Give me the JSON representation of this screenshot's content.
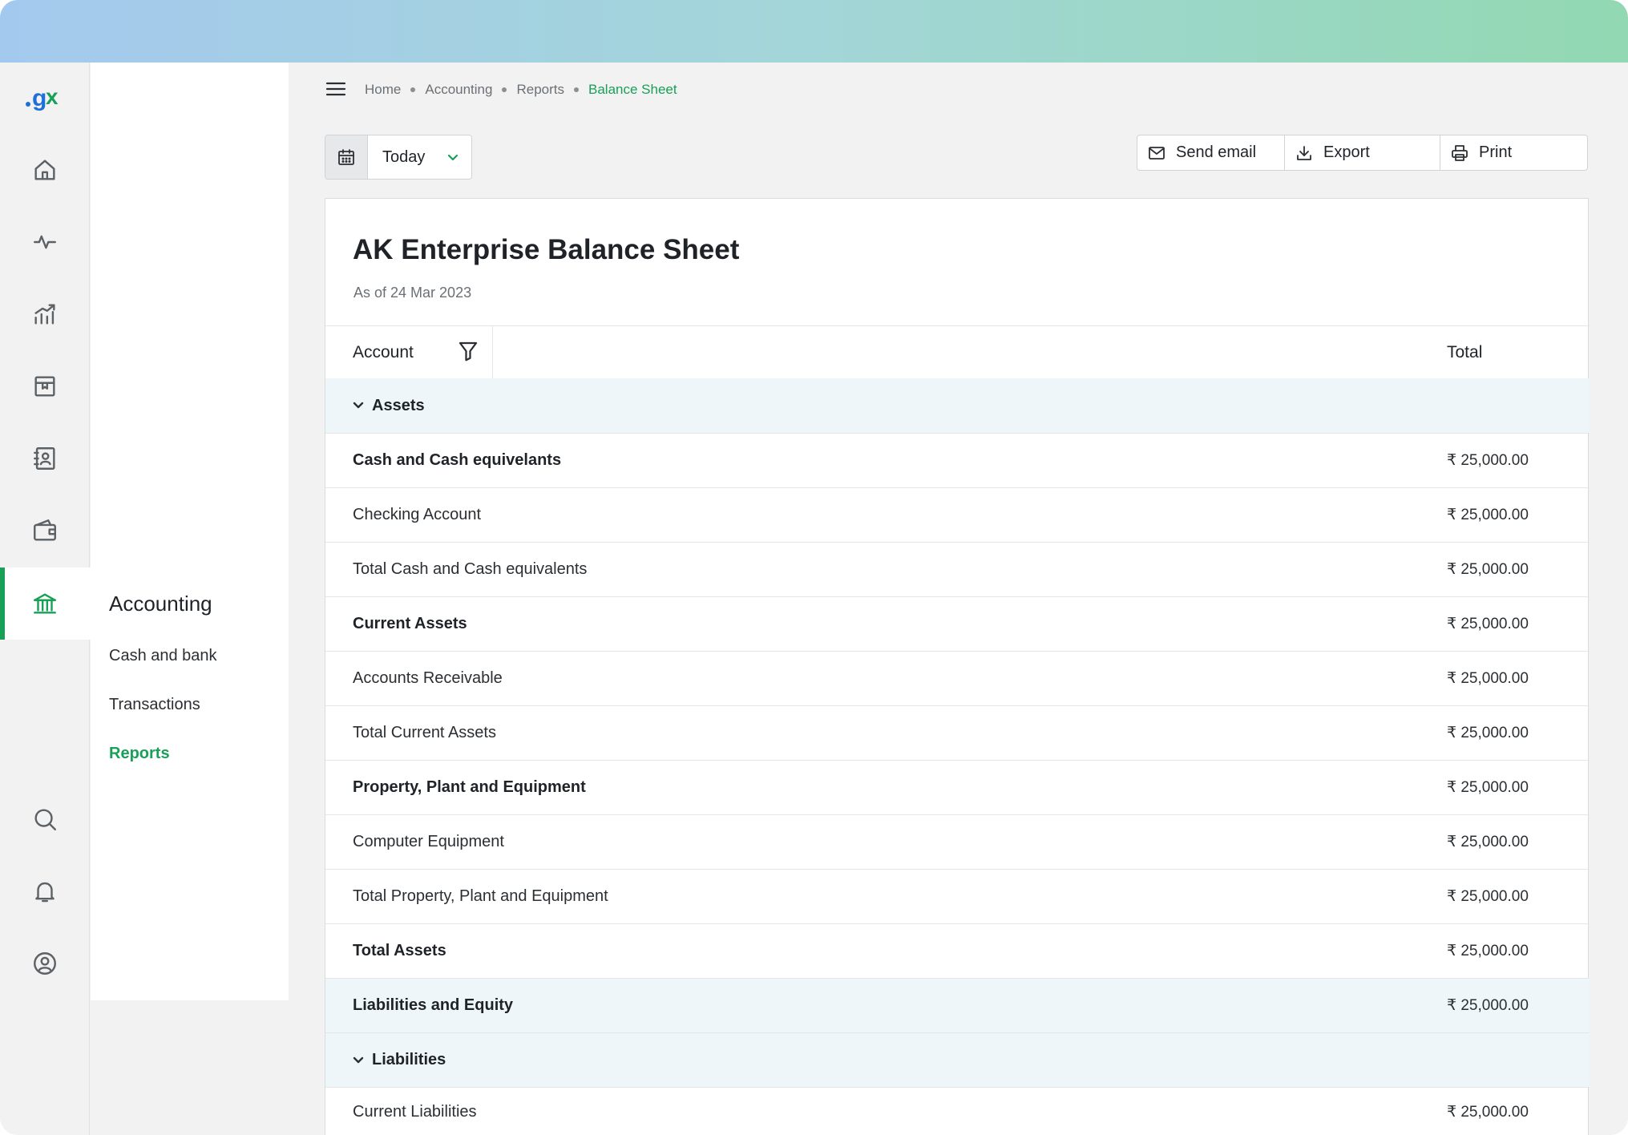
{
  "nav": {
    "rail_icons": [
      "home-icon",
      "activity-icon",
      "chart-icon",
      "inventory-icon",
      "contacts-icon",
      "wallet-icon",
      "bank-icon",
      "search-icon",
      "bell-icon",
      "profile-icon"
    ],
    "section_title": "Accounting",
    "items": [
      {
        "label": "Cash and bank"
      },
      {
        "label": "Transactions"
      },
      {
        "label": "Reports"
      }
    ]
  },
  "breadcrumb": [
    "Home",
    "Accounting",
    "Reports",
    "Balance Sheet"
  ],
  "date_filter": {
    "value": "Today"
  },
  "actions": {
    "send_email": "Send email",
    "export": "Export",
    "print": "Print"
  },
  "report": {
    "title": "AK Enterprise Balance Sheet",
    "as_of": "As of  24 Mar 2023",
    "col_account": "Account",
    "col_total": "Total",
    "rows": [
      {
        "label": "Assets",
        "amount": ""
      },
      {
        "label": "Cash and Cash equivelants",
        "amount": "₹ 25,000.00"
      },
      {
        "label": "Checking Account",
        "amount": "₹ 25,000.00"
      },
      {
        "label": "Total Cash and Cash equivalents",
        "amount": "₹ 25,000.00"
      },
      {
        "label": "Current Assets",
        "amount": "₹ 25,000.00"
      },
      {
        "label": "Accounts Receivable",
        "amount": "₹ 25,000.00"
      },
      {
        "label": "Total Current Assets",
        "amount": "₹ 25,000.00"
      },
      {
        "label": "Property, Plant and Equipment",
        "amount": "₹ 25,000.00"
      },
      {
        "label": "Computer Equipment",
        "amount": "₹ 25,000.00"
      },
      {
        "label": "Total  Property, Plant and Equipment",
        "amount": "₹ 25,000.00"
      },
      {
        "label": "Total Assets",
        "amount": "₹ 25,000.00"
      },
      {
        "label": "Liabilities and Equity",
        "amount": "₹ 25,000.00"
      },
      {
        "label": "Liabilities",
        "amount": ""
      },
      {
        "label": "Current Liabilities",
        "amount": "₹ 25,000.00"
      }
    ]
  },
  "colors": {
    "accent": "#18a058",
    "section_bg": "#eef6f9"
  }
}
